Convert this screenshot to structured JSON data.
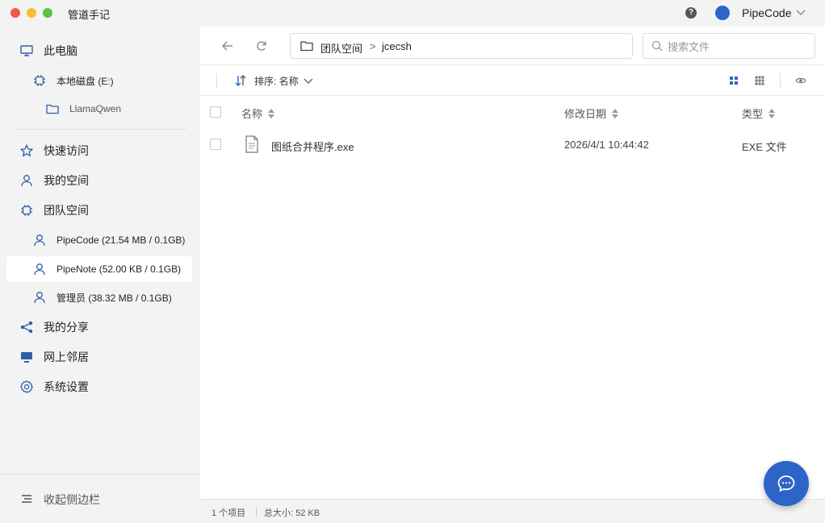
{
  "app": {
    "title": "管道手记"
  },
  "header": {
    "help_icon": "question-circle-icon",
    "user_name": "PipeCode",
    "user_color": "#2d64c8"
  },
  "sidebar": {
    "items": [
      {
        "label": "此电脑",
        "icon": "monitor-icon",
        "level": 0
      },
      {
        "label": "本地磁盘 (E:)",
        "icon": "chip-icon",
        "level": 1
      },
      {
        "label": "LlamaQwen",
        "icon": "folder-icon",
        "level": 2
      },
      {
        "label": "快速访问",
        "icon": "star-icon",
        "level": 0
      },
      {
        "label": "我的空间",
        "icon": "user-icon",
        "level": 0
      },
      {
        "label": "团队空间",
        "icon": "chip-icon",
        "level": 0
      },
      {
        "label": "PipeCode (21.54 MB / 0.1GB)",
        "icon": "user-icon",
        "level": 1
      },
      {
        "label": "PipeNote (52.00 KB / 0.1GB)",
        "icon": "user-icon",
        "level": 1,
        "active": true
      },
      {
        "label": "管理员 (38.32 MB / 0.1GB)",
        "icon": "user-icon",
        "level": 1
      },
      {
        "label": "我的分享",
        "icon": "share-icon",
        "level": 0
      },
      {
        "label": "网上邻居",
        "icon": "network-monitor-icon",
        "level": 0
      },
      {
        "label": "系统设置",
        "icon": "gear-icon",
        "level": 0
      }
    ],
    "collapse_label": "收起侧边栏"
  },
  "toolbar": {
    "path": [
      "团队空间",
      "jcecsh"
    ],
    "path_separator": ">",
    "search_placeholder": "搜索文件",
    "search_value": ""
  },
  "sortbar": {
    "label": "排序: 名称"
  },
  "table": {
    "columns": [
      "名称",
      "修改日期",
      "类型"
    ],
    "rows": [
      {
        "name": "图纸合并程序.exe",
        "date": "2026/4/1 10:44:42",
        "type": "EXE 文件",
        "icon": "document-icon"
      }
    ]
  },
  "status": {
    "count": "1 个项目",
    "size": "总大小: 52 KB"
  },
  "colors": {
    "accent": "#2d64c8",
    "sidebar_bg": "#f3f3f3"
  }
}
